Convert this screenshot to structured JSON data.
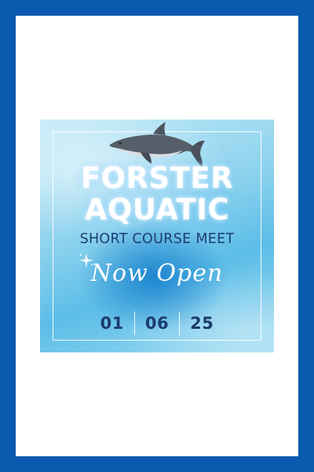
{
  "colors": {
    "border": "#0a5bb0",
    "page": "#ffffff",
    "water_light": "#bfe9f7",
    "water_mid": "#5cbde7",
    "glow": "#1f86cf",
    "title_text": "#ffffff",
    "subtitle_text": "#1e3e73",
    "date_text": "#1d3b6e"
  },
  "poster": {
    "illustration": "dolphin-icon",
    "decoration": "sparkle-icon",
    "title_line1": "FORSTER",
    "title_line2": "AQUATIC",
    "subtitle": "SHORT COURSE MEET",
    "script_text": "Now Open",
    "date": {
      "day": "01",
      "month": "06",
      "year": "25"
    }
  }
}
